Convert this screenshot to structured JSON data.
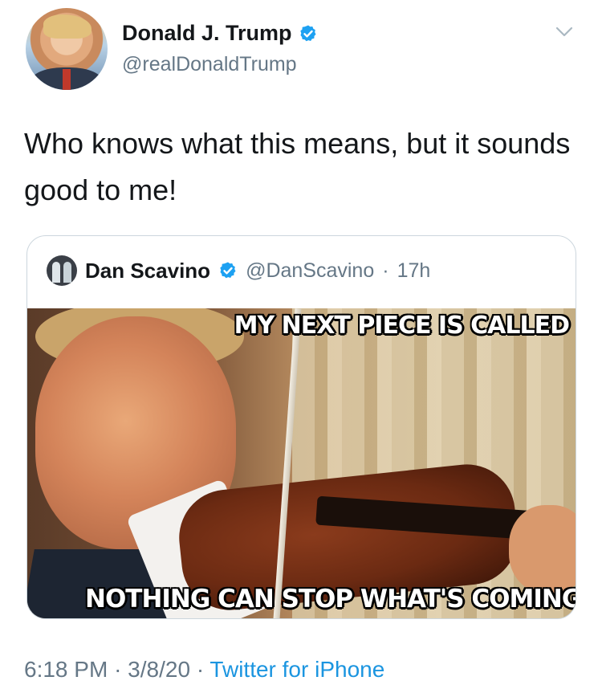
{
  "author": {
    "display_name": "Donald J. Trump",
    "handle": "@realDonaldTrump",
    "verified": true
  },
  "tweet": {
    "text": "Who knows what this means, but it sounds good to me!"
  },
  "quoted_tweet": {
    "display_name": "Dan Scavino",
    "handle": "@DanScavino",
    "separator": "·",
    "time_ago": "17h",
    "verified": true,
    "media": {
      "caption_top": "MY NEXT PIECE IS CALLED",
      "caption_bottom": "NOTHING CAN STOP WHAT'S COMING"
    }
  },
  "footer": {
    "time": "6:18 PM",
    "separator_1": "·",
    "date": "3/8/20",
    "separator_2": "·",
    "source": "Twitter for iPhone"
  },
  "colors": {
    "verified_blue": "#1da1f2",
    "link_blue": "#1b95e0",
    "secondary_text": "#657786",
    "border": "#ccd6dd"
  }
}
